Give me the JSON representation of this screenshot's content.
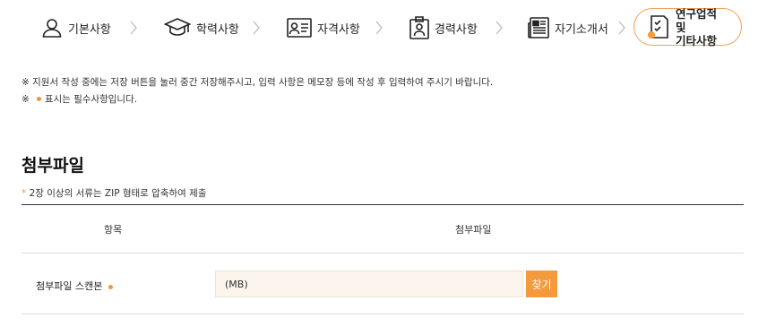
{
  "steps": [
    {
      "label": "기본사항",
      "icon": "person-icon"
    },
    {
      "label": "학력사항",
      "icon": "graduation-cap-icon"
    },
    {
      "label": "자격사항",
      "icon": "id-card-icon"
    },
    {
      "label": "경력사항",
      "icon": "badge-icon"
    },
    {
      "label": "자기소개서",
      "icon": "newspaper-icon"
    },
    {
      "label": "연구업적 및\n기타사항",
      "icon": "checklist-icon",
      "active": true
    }
  ],
  "notices": [
    "※ 지원서 작성 중에는 저장 버튼을 눌러 중간 저장해주시고, 입력 사항은 메모장 등에 작성 후 입력하여 주시기 바랍니다.",
    {
      "prefix": "※",
      "text": "표시는 필수사항입니다."
    }
  ],
  "section": {
    "title": "첨부파일",
    "note_star": "*",
    "note": "2장 이상의 서류는 ZIP 형태로 압축하여 제출"
  },
  "table": {
    "headers": [
      "항목",
      "첨부파일"
    ],
    "rows": [
      {
        "label": "첨부파일 스캔본",
        "required": true,
        "value": "(MB)",
        "button": "찾기"
      }
    ]
  },
  "colors": {
    "accent": "#f59a3c",
    "required_dot": "#f0953f",
    "input_bg": "#fbf5ee"
  }
}
